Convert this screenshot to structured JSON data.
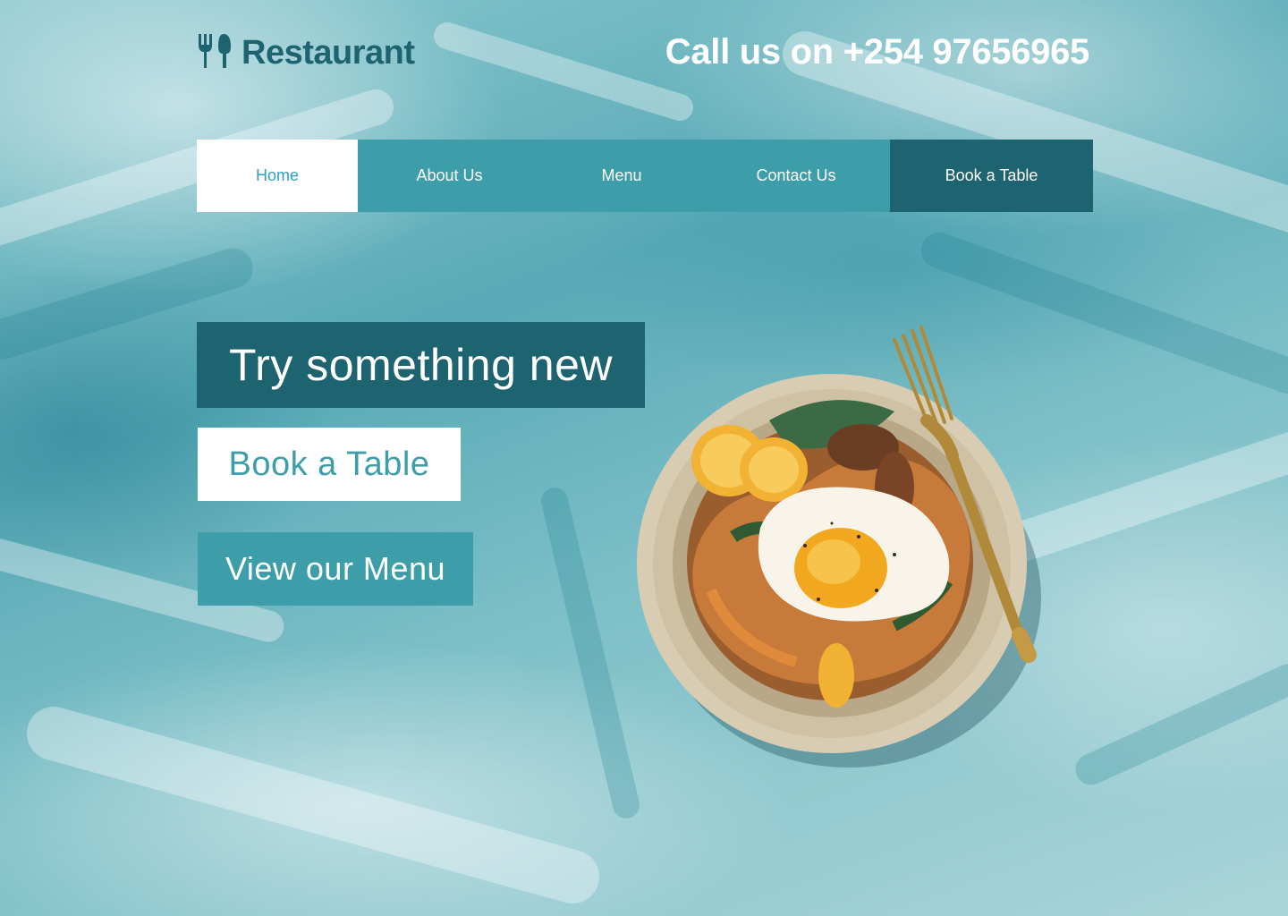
{
  "header": {
    "logo_icon": "fork-spoon-icon",
    "logo_text": "Restaurant",
    "phone_text": "Call us on +254 97656965"
  },
  "nav": {
    "items": [
      {
        "label": "Home",
        "active": true
      },
      {
        "label": "About Us"
      },
      {
        "label": "Menu"
      },
      {
        "label": "Contact Us"
      },
      {
        "label": "Book a Table"
      }
    ]
  },
  "hero": {
    "headline": "Try something new",
    "book_button": "Book a Table",
    "menu_button": "View our Menu"
  },
  "image": {
    "description_icon": "food-bowl-image"
  },
  "colors": {
    "dark_teal": "#1d6470",
    "teal": "#3d9ea9",
    "active_link": "#2e9fc4",
    "white": "#ffffff"
  }
}
